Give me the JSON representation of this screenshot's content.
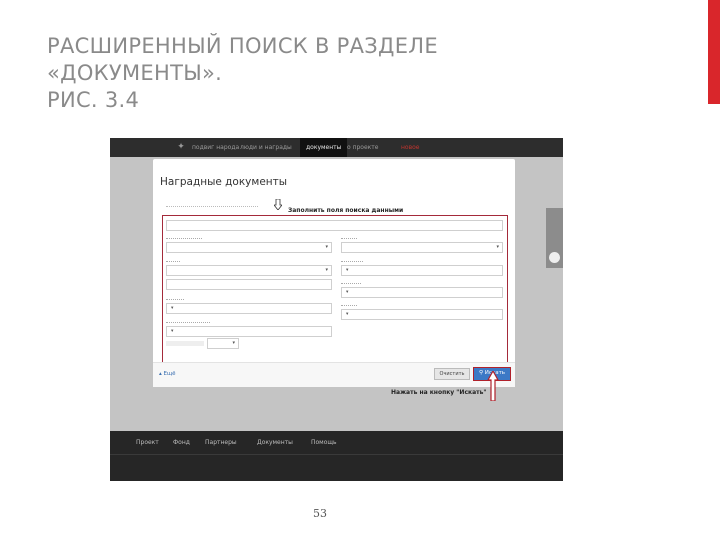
{
  "slide": {
    "title_lines": [
      "РАСШИРЕННЫЙ ПОИСК В РАЗДЕЛЕ",
      "«ДОКУМЕНТЫ».",
      "РИС. 3.4"
    ],
    "page_number": "53",
    "accent_color": "#d9262b"
  },
  "screenshot": {
    "nav": {
      "items": [
        "подвиг народа",
        "люди и награды",
        "документы",
        "о проекте",
        "новое"
      ],
      "active_index": 2
    },
    "page_title": "Наградные документы",
    "callout_top": "Заполнить поля поиска данными",
    "callout_bottom": "Нажать на кнопку \"Искать\"",
    "buttons": {
      "reset": "Очистить",
      "search": "Искать",
      "more": "Ещё"
    },
    "footer": {
      "links": [
        "Проект",
        "Фонд",
        "Партнеры",
        "Документы",
        "Помощь"
      ]
    },
    "colors": {
      "highlight_border": "#a42a3a",
      "search_button": "#3c79c6",
      "nav_bg": "#2d2d2d",
      "footer_bg": "#262626"
    }
  }
}
